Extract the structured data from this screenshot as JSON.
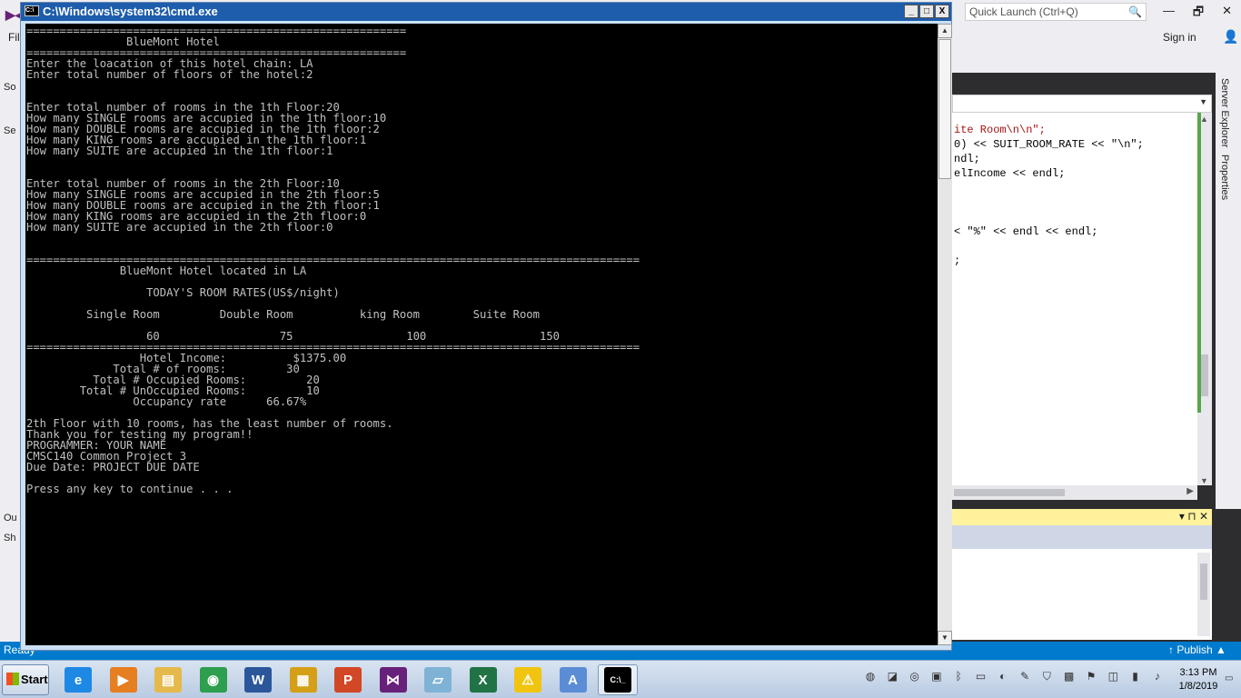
{
  "vs": {
    "logo": "▶◀",
    "menu_file": "File",
    "quick_launch_placeholder": "Quick Launch (Ctrl+Q)",
    "search_glyph": "🔍",
    "minimize_glyph": "—",
    "restore_glyph": "🗗",
    "close_glyph": "✕",
    "sign_in": "Sign in",
    "person_glyph": "👤",
    "left_tabs": [
      "So",
      "Se"
    ],
    "output_labels": [
      "Ou",
      "Sh"
    ],
    "server_explorer": "Server Explorer",
    "properties": "Properties",
    "code_lines": [
      "ite Room\\n\\n\";",
      "0) << SUIT_ROOM_RATE << \"\\n\";",
      "ndl;",
      "elIncome << endl;",
      "",
      "",
      "",
      "< \"%\" << endl << endl;",
      "",
      ";"
    ],
    "status_ready": "Ready",
    "status_publish": "↑ Publish ▲"
  },
  "cmd": {
    "title": "C:\\Windows\\system32\\cmd.exe",
    "icon_label": "C:\\",
    "minimize_glyph": "_",
    "maximize_glyph": "□",
    "close_glyph": "X",
    "scroll_up": "▲",
    "scroll_down": "▼",
    "output": "=========================================================\n               BlueMont Hotel\n=========================================================\nEnter the loacation of this hotel chain: LA\nEnter total number of floors of the hotel:2\n\n\nEnter total number of rooms in the 1th Floor:20\nHow many SINGLE rooms are accupied in the 1th floor:10\nHow many DOUBLE rooms are accupied in the 1th floor:2\nHow many KING rooms are accupied in the 1th floor:1\nHow many SUITE are accupied in the 1th floor:1\n\n\nEnter total number of rooms in the 2th Floor:10\nHow many SINGLE rooms are accupied in the 2th floor:5\nHow many DOUBLE rooms are accupied in the 2th floor:1\nHow many KING rooms are accupied in the 2th floor:0\nHow many SUITE are accupied in the 2th floor:0\n\n\n============================================================================================\n              BlueMont Hotel located in LA\n\n                  TODAY'S ROOM RATES(US$/night)\n\n         Single Room         Double Room          king Room        Suite Room\n\n                  60                  75                 100                 150\n============================================================================================\n                 Hotel Income:          $1375.00\n             Total # of rooms:         30\n          Total # Occupied Rooms:         20\n        Total # UnOccupied Rooms:         10\n                Occupancy rate      66.67%\n\n2th Floor with 10 rooms, has the least number of rooms.\nThank you for testing my program!!\nPROGRAMMER: YOUR NAME\nCMSC140 Common Project 3\nDue Date: PROJECT DUE DATE\n\nPress any key to continue . . ."
  },
  "taskbar": {
    "start_label": "Start",
    "apps": [
      {
        "name": "internet-explorer",
        "glyph": "e",
        "color": "#1e88e5"
      },
      {
        "name": "media-player",
        "glyph": "▶",
        "color": "#e67e22"
      },
      {
        "name": "file-explorer",
        "glyph": "▤",
        "color": "#e5b94c"
      },
      {
        "name": "chrome",
        "glyph": "◉",
        "color": "#2e9e4f"
      },
      {
        "name": "word",
        "glyph": "W",
        "color": "#2b579a"
      },
      {
        "name": "archive",
        "glyph": "▦",
        "color": "#d4a017"
      },
      {
        "name": "powerpoint",
        "glyph": "P",
        "color": "#d24726"
      },
      {
        "name": "visual-studio",
        "glyph": "⋈",
        "color": "#68217a"
      },
      {
        "name": "notepad",
        "glyph": "▱",
        "color": "#7fb3d5"
      },
      {
        "name": "excel",
        "glyph": "X",
        "color": "#217346"
      },
      {
        "name": "warning-app",
        "glyph": "⚠",
        "color": "#f1c40f"
      },
      {
        "name": "document-app",
        "glyph": "A",
        "color": "#5b8dd6"
      },
      {
        "name": "cmd",
        "glyph": "C:\\_",
        "color": "#000000"
      }
    ],
    "tray_icons": [
      "◍",
      "◪",
      "◎",
      "▣",
      "ᛒ",
      "▭",
      "◐",
      "✎",
      "⛉",
      "▩",
      "⚑",
      "◫",
      "▮",
      "♪"
    ],
    "time": "3:13 PM",
    "date": "1/8/2019"
  }
}
